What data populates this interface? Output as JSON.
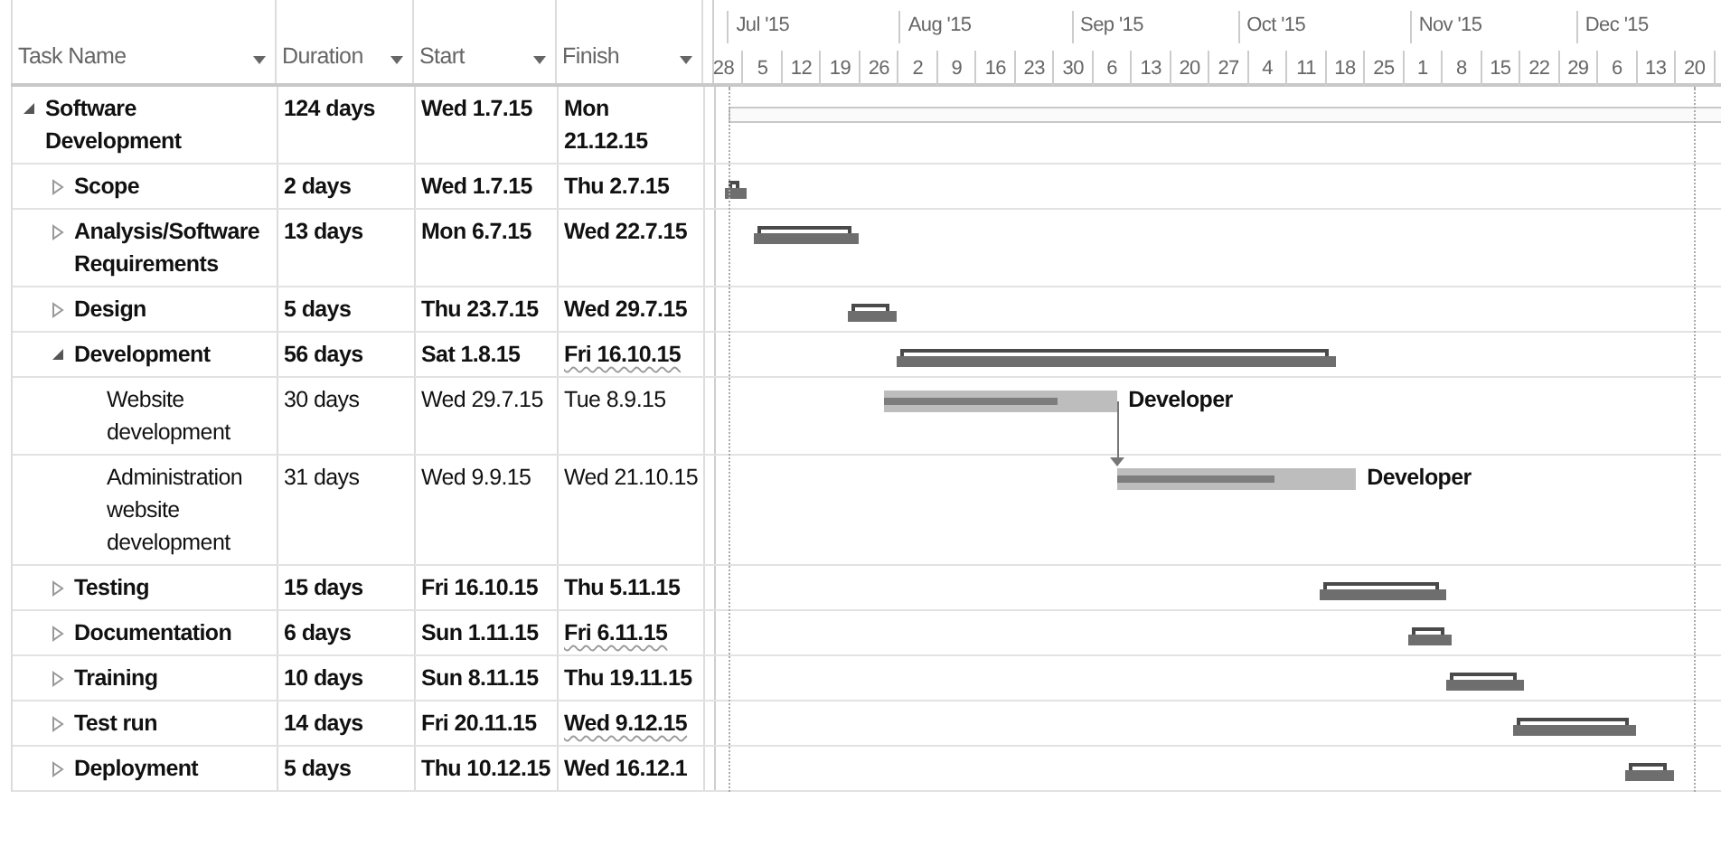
{
  "columns": [
    {
      "label": "Task Name"
    },
    {
      "label": "Duration"
    },
    {
      "label": "Start"
    },
    {
      "label": "Finish"
    }
  ],
  "timescale": {
    "months": [
      "Jul '15",
      "Aug '15",
      "Sep '15",
      "Oct '15",
      "Nov '15",
      "Dec '15"
    ],
    "weeks": [
      "28",
      "5",
      "12",
      "19",
      "26",
      "2",
      "9",
      "16",
      "23",
      "30",
      "6",
      "13",
      "20",
      "27",
      "4",
      "11",
      "18",
      "25",
      "1",
      "8",
      "15",
      "22",
      "29",
      "6",
      "13",
      "20"
    ]
  },
  "tasks": [
    {
      "name": "Software Development",
      "duration": "124 days",
      "start": "Wed 1.7.15",
      "finish": "Mon 21.12.15",
      "kind": "project",
      "expanded": true,
      "changed": false,
      "children": [
        {
          "name": "Scope",
          "duration": "2 days",
          "start": "Wed 1.7.15",
          "finish": "Thu 2.7.15",
          "kind": "summary",
          "expanded": false,
          "changed": false
        },
        {
          "name": "Analysis/Software Requirements",
          "duration": "13 days",
          "start": "Mon 6.7.15",
          "finish": "Wed 22.7.15",
          "kind": "summary",
          "expanded": false,
          "changed": false
        },
        {
          "name": "Design",
          "duration": "5 days",
          "start": "Thu 23.7.15",
          "finish": "Wed 29.7.15",
          "kind": "summary",
          "expanded": false,
          "changed": false
        },
        {
          "name": "Development",
          "duration": "56 days",
          "start": "Sat 1.8.15",
          "finish": "Fri 16.10.15",
          "kind": "summary",
          "expanded": true,
          "changed": true,
          "children": [
            {
              "name": "Website development",
              "duration": "30 days",
              "start": "Wed 29.7.15",
              "finish": "Tue 8.9.15",
              "kind": "task",
              "changed": false,
              "resource": "Developer",
              "level": 0.74,
              "link_to_next": true
            },
            {
              "name": "Administration website development",
              "duration": "31 days",
              "start": "Wed 9.9.15",
              "finish": "Wed 21.10.15",
              "kind": "task",
              "changed": false,
              "resource": "Developer",
              "level": 0.66
            }
          ]
        },
        {
          "name": "Testing",
          "duration": "15 days",
          "start": "Fri 16.10.15",
          "finish": "Thu 5.11.15",
          "kind": "summary",
          "expanded": false,
          "changed": false
        },
        {
          "name": "Documentation",
          "duration": "6 days",
          "start": "Sun 1.11.15",
          "finish": "Fri 6.11.15",
          "kind": "summary",
          "expanded": false,
          "changed": true
        },
        {
          "name": "Training",
          "duration": "10 days",
          "start": "Sun 8.11.15",
          "finish": "Thu 19.11.15",
          "kind": "summary",
          "expanded": false,
          "changed": false
        },
        {
          "name": "Test run",
          "duration": "14 days",
          "start": "Fri 20.11.15",
          "finish": "Wed 9.12.15",
          "kind": "summary",
          "expanded": false,
          "changed": true
        },
        {
          "name": "Deployment",
          "duration": "5 days",
          "start": "Thu 10.12.15",
          "finish": "Wed 16.12.1",
          "kind": "summary",
          "expanded": false,
          "changed": false
        }
      ]
    }
  ]
}
